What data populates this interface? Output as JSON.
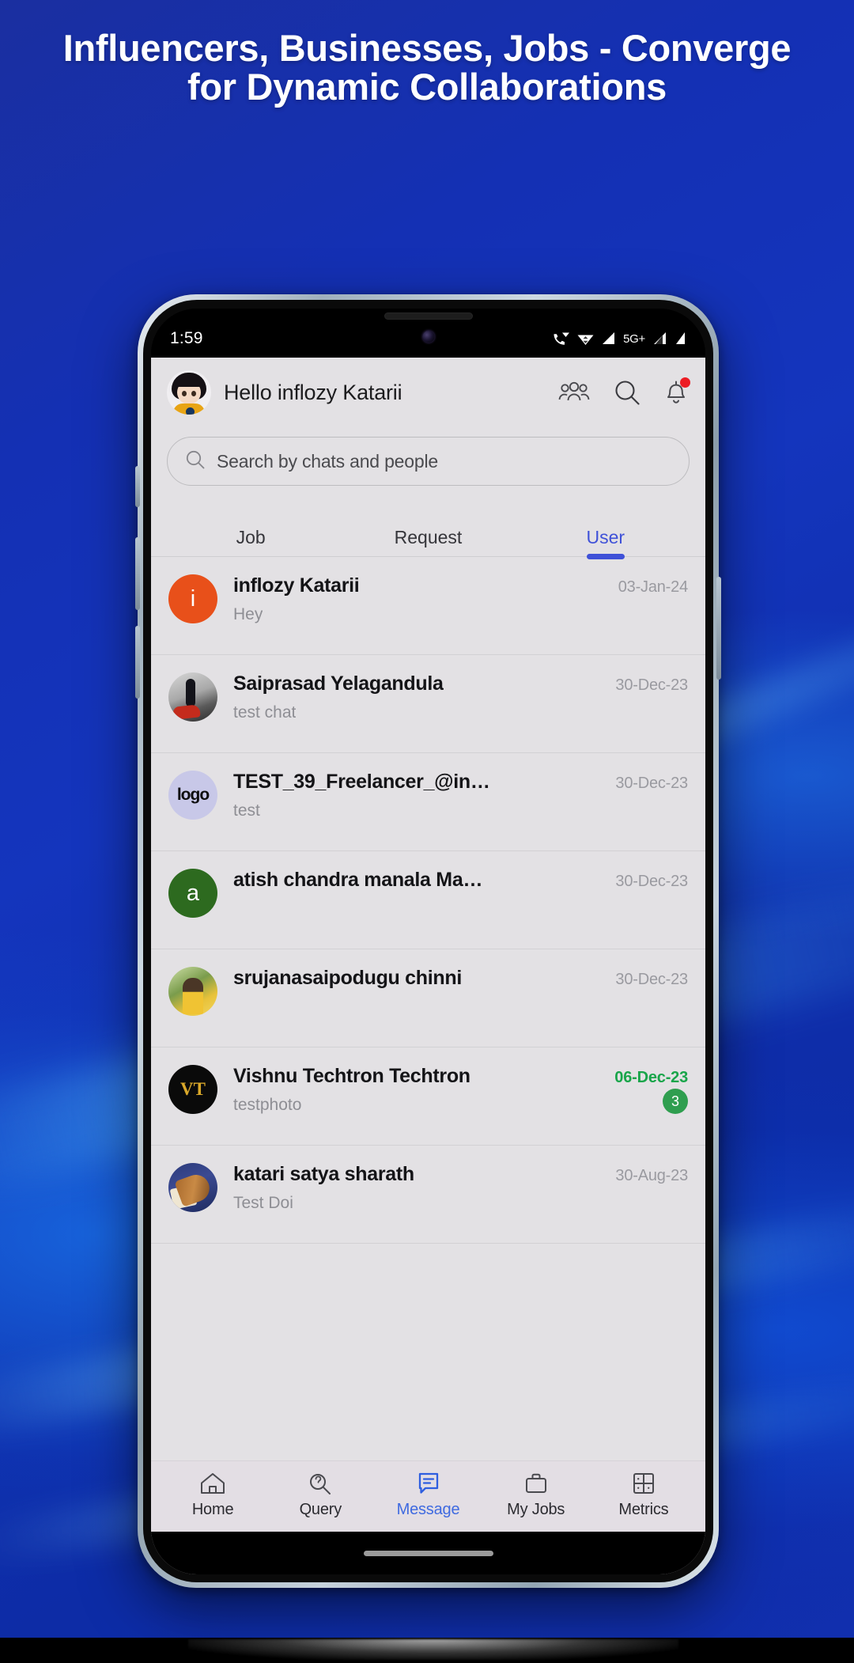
{
  "poster": {
    "headline_line1": "Influencers, Businesses, Jobs - Converge",
    "headline_line2": "for Dynamic Collaborations",
    "accent_blue": "#1430b4",
    "headline_color": "#ffffff"
  },
  "status_bar": {
    "time": "1:59",
    "network_label": "5G+",
    "icons": [
      "call-wifi-icon",
      "wifi-icon",
      "signal-icon",
      "signal-2-icon",
      "battery-icon"
    ]
  },
  "app_header": {
    "greeting": "Hello inflozy Katarii",
    "avatar_name": "user-avatar",
    "icons": [
      {
        "name": "group-icon",
        "label": "Groups"
      },
      {
        "name": "search-icon",
        "label": "Search"
      },
      {
        "name": "bell-icon",
        "label": "Notifications",
        "has_badge": true
      }
    ]
  },
  "search": {
    "placeholder": "Search by chats and people",
    "value": ""
  },
  "tabs": [
    {
      "label": "Job",
      "active": false
    },
    {
      "label": "Request",
      "active": false
    },
    {
      "label": "User",
      "active": true
    }
  ],
  "tab_active_color": "#3f51d8",
  "chats": [
    {
      "name": "inflozy Katarii",
      "message": "Hey",
      "date": "03-Jan-24",
      "avatar_kind": "initial",
      "initial": "i",
      "avatar_color": "#e8501a",
      "unread": "",
      "unread_highlight": false
    },
    {
      "name": "Saiprasad Yelagandula",
      "message": "test chat",
      "date": "30-Dec-23",
      "avatar_kind": "photo-1",
      "initial": "",
      "avatar_color": "",
      "unread": "",
      "unread_highlight": false
    },
    {
      "name": "TEST_39_Freelancer_@infl…",
      "message": "test",
      "date": "30-Dec-23",
      "avatar_kind": "photo-2",
      "initial": "logo",
      "avatar_color": "#c8c8e8",
      "unread": "",
      "unread_highlight": false
    },
    {
      "name": "atish chandra manala Man…",
      "message": "",
      "date": "30-Dec-23",
      "avatar_kind": "initial",
      "initial": "a",
      "avatar_color": "#2d6a1f",
      "unread": "",
      "unread_highlight": false
    },
    {
      "name": "srujanasaipodugu chinni",
      "message": "",
      "date": "30-Dec-23",
      "avatar_kind": "photo-3",
      "initial": "",
      "avatar_color": "",
      "unread": "",
      "unread_highlight": false
    },
    {
      "name": "Vishnu Techtron Techtron",
      "message": "testphoto",
      "date": "06-Dec-23",
      "avatar_kind": "photo-4",
      "initial": "VT",
      "avatar_color": "#0a0a0a",
      "unread": "3",
      "unread_highlight": true
    },
    {
      "name": "katari satya sharath",
      "message": "Test Doi",
      "date": "30-Aug-23",
      "avatar_kind": "photo-5",
      "initial": "",
      "avatar_color": "",
      "unread": "",
      "unread_highlight": false
    }
  ],
  "unread_badge_color": "#2f9e4f",
  "unread_date_color": "#19a54a",
  "bottom_nav": [
    {
      "label": "Home",
      "icon": "home-icon",
      "active": false
    },
    {
      "label": "Query",
      "icon": "query-search-icon",
      "active": false
    },
    {
      "label": "Message",
      "icon": "message-icon",
      "active": true
    },
    {
      "label": "My Jobs",
      "icon": "briefcase-icon",
      "active": false
    },
    {
      "label": "Metrics",
      "icon": "grid-metrics-icon",
      "active": false
    }
  ],
  "nav_active_color": "#3f6ae0"
}
